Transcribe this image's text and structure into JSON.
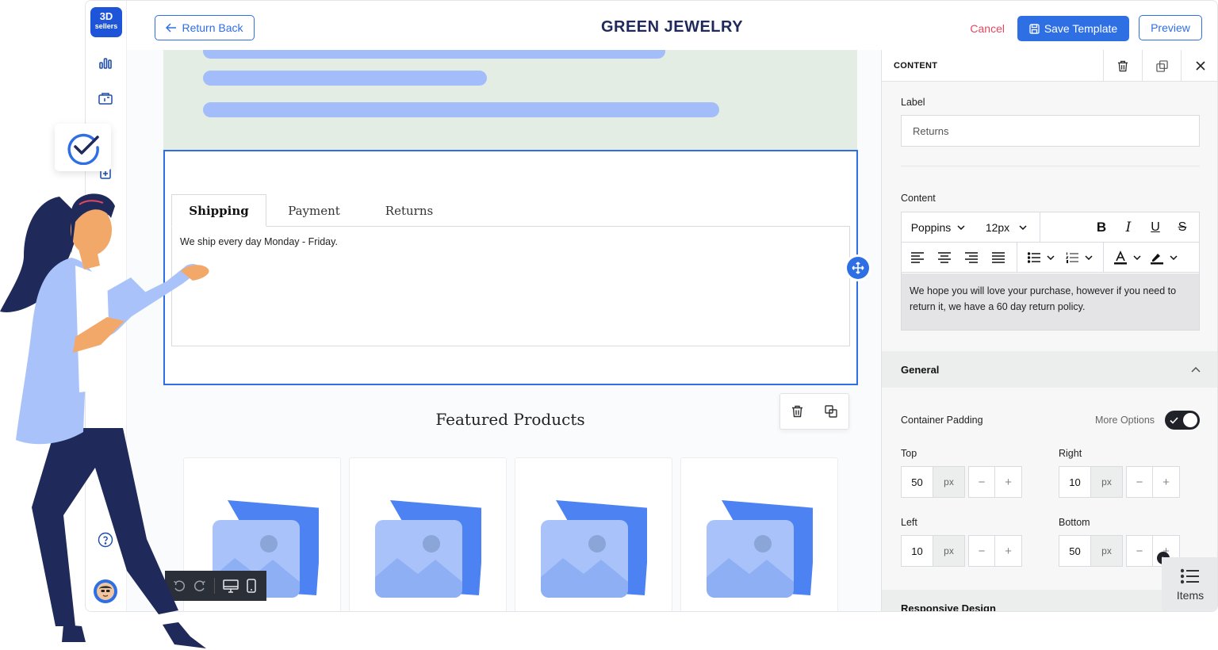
{
  "app": {
    "logo_line1": "3D",
    "logo_line2": "sellers",
    "title": "GREEN JEWELRY",
    "colors": {
      "accent": "#2f6fe4",
      "cancel": "#e2475f",
      "title": "#1f2a5a",
      "hero_bg": "#e3ede3",
      "bars": "#a3bdfa"
    }
  },
  "toolbar": {
    "return_label": "Return Back",
    "cancel_label": "Cancel",
    "save_label": "Save Template",
    "preview_label": "Preview"
  },
  "rail": {
    "icons": [
      "analytics-icon",
      "store-icon",
      "add-page-icon",
      "calendar-icon",
      "help-icon",
      "user-avatar"
    ]
  },
  "canvas": {
    "tabs": [
      {
        "label": "Shipping",
        "active": true
      },
      {
        "label": "Payment",
        "active": false
      },
      {
        "label": "Returns",
        "active": false
      }
    ],
    "tab_content": "We ship every day Monday - Friday.",
    "featured_title": "Featured Products"
  },
  "panel": {
    "header_title": "CONTENT",
    "label_heading": "Label",
    "label_value": "Returns",
    "content_heading": "Content",
    "font_family": "Poppins",
    "font_size": "12px",
    "editor_text": "We hope you will love your purchase, however if you need to return it, we have a 60 day return policy.",
    "general_heading": "General",
    "container_padding_label": "Container Padding",
    "more_options_label": "More Options",
    "padding": {
      "top_label": "Top",
      "top_value": "50",
      "right_label": "Right",
      "right_value": "10",
      "left_label": "Left",
      "left_value": "10",
      "bottom_label": "Bottom",
      "bottom_value": "50",
      "unit": "px"
    },
    "responsive_heading": "Responsive Design",
    "items_label": "Items"
  }
}
